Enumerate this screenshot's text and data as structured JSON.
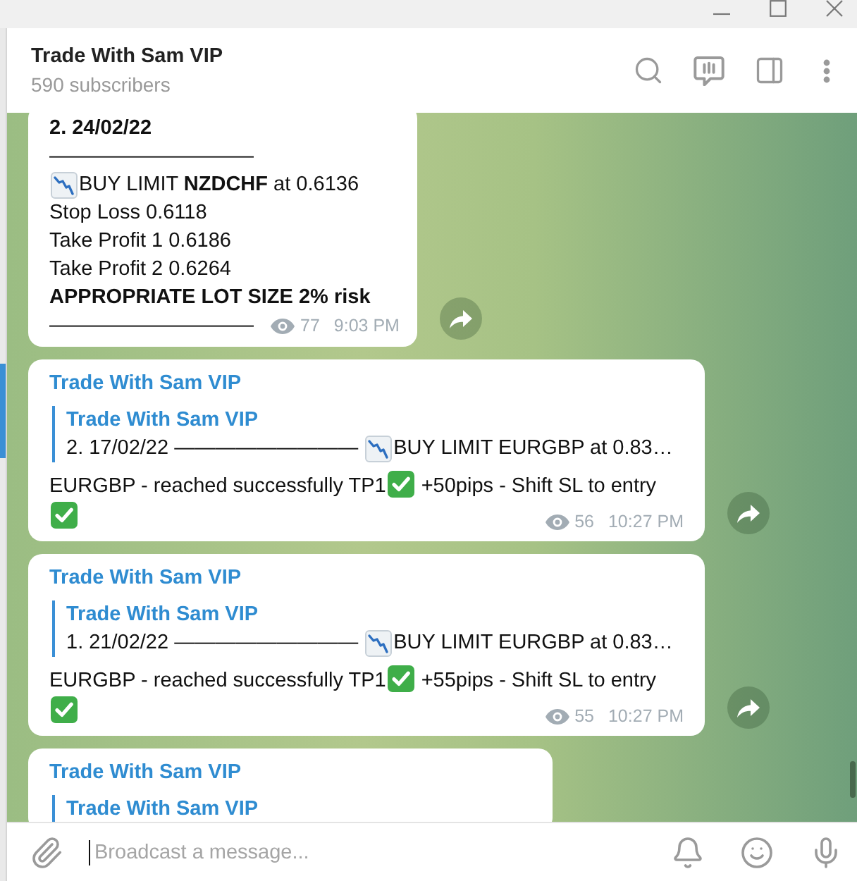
{
  "header": {
    "title": "Trade With Sam VIP",
    "subtitle": "590 subscribers"
  },
  "messages": [
    {
      "kind": "post",
      "lines": [
        {
          "bold": true,
          "parts": [
            {
              "kind": "text",
              "text": "2. 24/02/22"
            }
          ]
        },
        {
          "bold": false,
          "parts": [
            {
              "kind": "text",
              "text": "——————————"
            }
          ]
        },
        {
          "bold": false,
          "parts": [
            {
              "kind": "chart_down"
            },
            {
              "kind": "text",
              "text": "BUY LIMIT **NZDCHF** at 0.6136"
            }
          ]
        },
        {
          "bold": false,
          "parts": [
            {
              "kind": "text",
              "text": "Stop Loss 0.6118"
            }
          ]
        },
        {
          "bold": false,
          "parts": [
            {
              "kind": "text",
              "text": "Take Profit 1 0.6186"
            }
          ]
        },
        {
          "bold": false,
          "parts": [
            {
              "kind": "text",
              "text": "Take Profit 2 0.6264"
            }
          ]
        },
        {
          "bold": true,
          "parts": [
            {
              "kind": "text",
              "text": "APPROPRIATE LOT SIZE 2% risk"
            }
          ]
        }
      ],
      "last_line": "——————————",
      "views": "77",
      "time": "9:03 PM"
    },
    {
      "kind": "reply",
      "sender": "Trade With Sam VIP",
      "quote": {
        "author": "Trade With Sam VIP",
        "parts": [
          {
            "kind": "text",
            "text": "2. 17/02/22 ————————— "
          },
          {
            "kind": "chart_down"
          },
          {
            "kind": "text",
            "text": "BUY LIMIT EURGBP at 0.83…"
          }
        ]
      },
      "parts": [
        {
          "kind": "text",
          "text": "EURGBP - reached successfully TP1"
        },
        {
          "kind": "check"
        },
        {
          "kind": "text",
          "text": " +50pips - Shift SL to entry "
        },
        {
          "kind": "check"
        }
      ],
      "views": "56",
      "time": "10:27 PM"
    },
    {
      "kind": "reply",
      "sender": "Trade With Sam VIP",
      "quote": {
        "author": "Trade With Sam VIP",
        "parts": [
          {
            "kind": "text",
            "text": "1. 21/02/22 ————————— "
          },
          {
            "kind": "chart_down"
          },
          {
            "kind": "text",
            "text": "BUY LIMIT EURGBP at 0.83…"
          }
        ]
      },
      "parts": [
        {
          "kind": "text",
          "text": "EURGBP - reached successfully TP1"
        },
        {
          "kind": "check"
        },
        {
          "kind": "text",
          "text": " +55pips - Shift SL to entry "
        },
        {
          "kind": "check"
        }
      ],
      "views": "55",
      "time": "10:27 PM"
    },
    {
      "kind": "reply",
      "sender": "Trade With Sam VIP",
      "quote": {
        "author": "Trade With Sam VIP"
      }
    }
  ],
  "composer": {
    "placeholder": "Broadcast a message..."
  }
}
